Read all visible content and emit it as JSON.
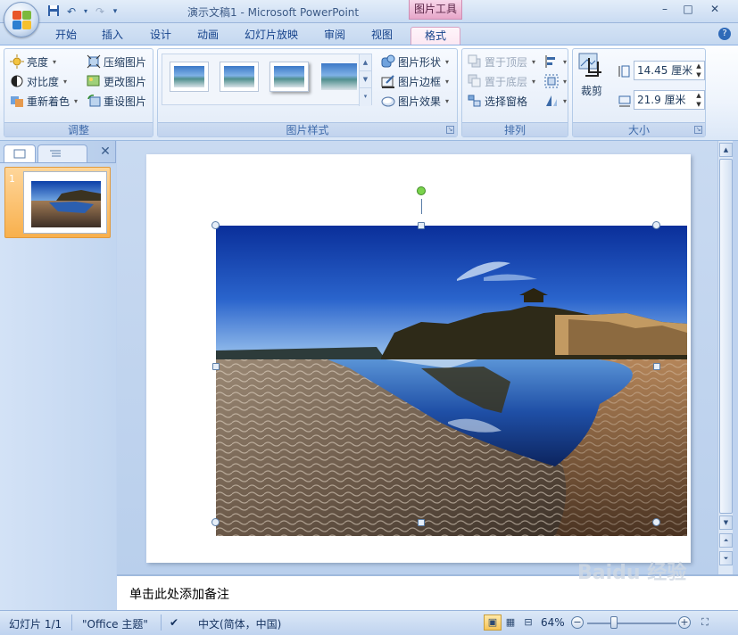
{
  "window": {
    "title": "演示文稿1 - Microsoft PowerPoint",
    "context_tool": "图片工具",
    "minimize": "–",
    "maximize": "□",
    "close": "✕"
  },
  "tabs": [
    {
      "label": "开始"
    },
    {
      "label": "插入"
    },
    {
      "label": "设计"
    },
    {
      "label": "动画"
    },
    {
      "label": "幻灯片放映"
    },
    {
      "label": "审阅"
    },
    {
      "label": "视图"
    },
    {
      "label": "格式",
      "active": true
    }
  ],
  "ribbon": {
    "adjust": {
      "label": "调整",
      "brightness": "亮度",
      "contrast": "对比度",
      "recolor": "重新着色",
      "compress": "压缩图片",
      "change": "更改图片",
      "reset": "重设图片"
    },
    "styles": {
      "label": "图片样式",
      "shape": "图片形状",
      "border": "图片边框",
      "effects": "图片效果"
    },
    "arrange": {
      "label": "排列",
      "front": "置于顶层",
      "back": "置于底层",
      "selection_pane": "选择窗格"
    },
    "size": {
      "label": "大小",
      "crop": "裁剪",
      "height": "14.45 厘米",
      "width": "21.9 厘米"
    }
  },
  "slides_panel": {
    "slide_number": "1"
  },
  "notes": {
    "placeholder": "单击此处添加备注"
  },
  "watermark": "Baidu 经验",
  "status": {
    "slide": "幻灯片 1/1",
    "theme": "\"Office 主题\"",
    "language": "中文(简体，中国)",
    "zoom": "64%",
    "zoom_fraction": 0.64
  },
  "colors": {
    "ribbon_bg": "#e6eef9",
    "context_tab": "#e7a6c9",
    "accent": "#15428b"
  }
}
